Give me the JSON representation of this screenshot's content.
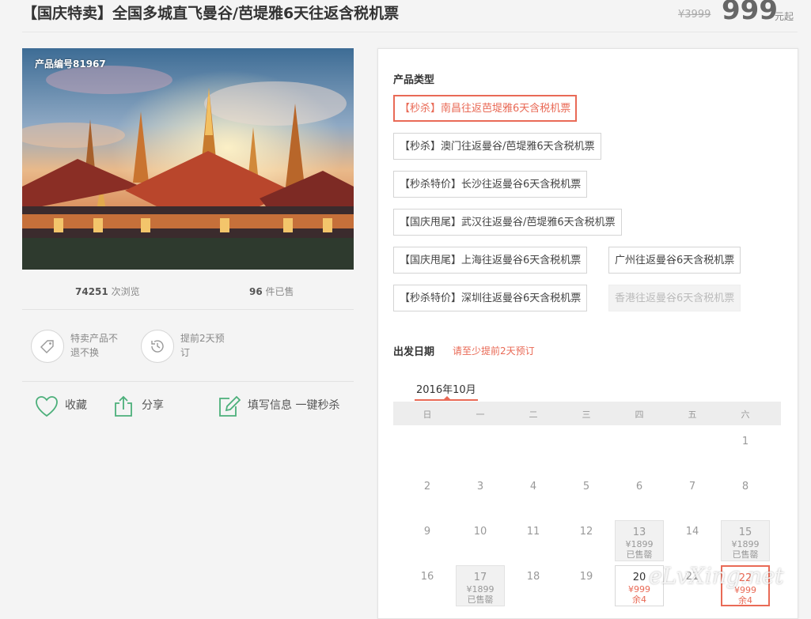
{
  "header": {
    "title": "【国庆特卖】全国多城直飞曼谷/芭堤雅6天往返含税机票",
    "original_price": "¥3999",
    "price": "999",
    "price_unit": "元起"
  },
  "product": {
    "code_label": "产品编号81967",
    "views_count": "74251",
    "views_label": "次浏览",
    "sold_count": "96",
    "sold_label": "件已售"
  },
  "features": [
    {
      "icon": "tag-icon",
      "text": "特卖产品不退不换"
    },
    {
      "icon": "clock-icon",
      "text": "提前2天预订"
    }
  ],
  "actions": {
    "favorite": "收藏",
    "share": "分享",
    "fill_info": "填写信息 一键秒杀"
  },
  "product_type": {
    "title": "产品类型",
    "options": [
      {
        "label": "【秒杀】南昌往返芭堤雅6天含税机票",
        "state": "selected"
      },
      {
        "label": "【秒杀】澳门往返曼谷/芭堤雅6天含税机票",
        "state": "normal"
      },
      {
        "label": "【秒杀特价】长沙往返曼谷6天含税机票",
        "state": "normal"
      },
      {
        "label": "【国庆甩尾】武汉往返曼谷/芭堤雅6天含税机票",
        "state": "normal"
      },
      {
        "label": "【国庆甩尾】上海往返曼谷6天含税机票",
        "state": "normal"
      },
      {
        "label": "广州往返曼谷6天含税机票",
        "state": "normal"
      },
      {
        "label": "【秒杀特价】深圳往返曼谷6天含税机票",
        "state": "normal"
      },
      {
        "label": "香港往返曼谷6天含税机票",
        "state": "disabled"
      }
    ]
  },
  "departure": {
    "title": "出发日期",
    "hint": "请至少提前2天预订",
    "month": "2016年10月",
    "weekdays": [
      "日",
      "一",
      "二",
      "三",
      "四",
      "五",
      "六"
    ],
    "days": [
      {
        "d": "1"
      },
      {
        "d": "2"
      },
      {
        "d": "3"
      },
      {
        "d": "4"
      },
      {
        "d": "5"
      },
      {
        "d": "6"
      },
      {
        "d": "7"
      },
      {
        "d": "8"
      },
      {
        "d": "9"
      },
      {
        "d": "10"
      },
      {
        "d": "11"
      },
      {
        "d": "12"
      },
      {
        "d": "13",
        "price": "¥1899",
        "status": "已售罄"
      },
      {
        "d": "14"
      },
      {
        "d": "15",
        "price": "¥1899",
        "status": "已售罄"
      },
      {
        "d": "16"
      },
      {
        "d": "17",
        "price": "¥1899",
        "status": "已售罄"
      },
      {
        "d": "18"
      },
      {
        "d": "19"
      },
      {
        "d": "20",
        "price": "¥999",
        "status": "余4"
      },
      {
        "d": "21"
      },
      {
        "d": "22",
        "price": "¥999",
        "status": "余4"
      }
    ]
  },
  "watermark": "eLvXing.net"
}
